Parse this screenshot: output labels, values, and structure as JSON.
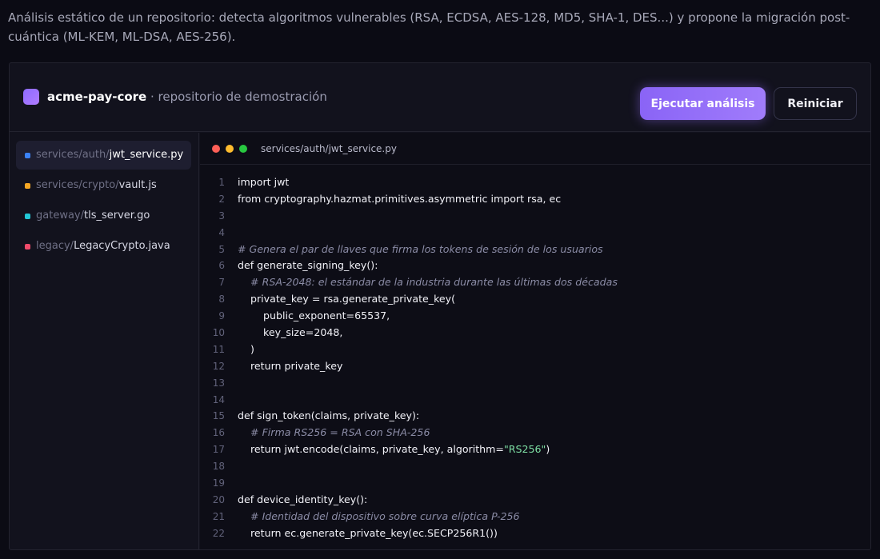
{
  "intro": "Análisis estático de un repositorio: detecta algoritmos vulnerables (RSA, ECDSA, AES-128, MD5, SHA-1, DES...) y propone la migración post-cuántica (ML-KEM, ML-DSA, AES-256).",
  "header": {
    "repo_name": "acme-pay-core",
    "separator": " · ",
    "repo_subtitle": "repositorio de demostración",
    "run_label": "Ejecutar análisis",
    "reset_label": "Reiniciar"
  },
  "colors": {
    "accent": "#9b72fa",
    "dot_blue": "#3b82f6",
    "dot_orange": "#f5a623",
    "dot_cyan": "#22c7d6",
    "dot_red": "#f04a6a"
  },
  "files": [
    {
      "dir": "services/auth/",
      "name": "jwt_service.py",
      "dot": "#3b82f6",
      "active": true
    },
    {
      "dir": "services/crypto/",
      "name": "vault.js",
      "dot": "#f5a623",
      "active": false
    },
    {
      "dir": "gateway/",
      "name": "tls_server.go",
      "dot": "#22c7d6",
      "active": false
    },
    {
      "dir": "legacy/",
      "name": "LegacyCrypto.java",
      "dot": "#f04a6a",
      "active": false
    }
  ],
  "editor": {
    "tab_path": "services/auth/jwt_service.py",
    "window_lights": [
      "#ff5f57",
      "#febc2e",
      "#28c840"
    ],
    "lines": [
      {
        "n": "1",
        "text": "import jwt"
      },
      {
        "n": "2",
        "text": "from cryptography.hazmat.primitives.asymmetric import rsa, ec"
      },
      {
        "n": "3",
        "text": ""
      },
      {
        "n": "4",
        "text": ""
      },
      {
        "n": "5",
        "text": "# Genera el par de llaves que firma los tokens de sesión de los usuarios",
        "comment": true
      },
      {
        "n": "6",
        "text": "def generate_signing_key():"
      },
      {
        "n": "7",
        "text": "    # RSA-2048: el estándar de la industria durante las últimas dos décadas",
        "comment": true
      },
      {
        "n": "8",
        "text": "    private_key = rsa.generate_private_key("
      },
      {
        "n": "9",
        "text": "        public_exponent=65537,"
      },
      {
        "n": "10",
        "text": "        key_size=2048,"
      },
      {
        "n": "11",
        "text": "    )"
      },
      {
        "n": "12",
        "text": "    return private_key"
      },
      {
        "n": "13",
        "text": ""
      },
      {
        "n": "14",
        "text": ""
      },
      {
        "n": "15",
        "text": "def sign_token(claims, private_key):"
      },
      {
        "n": "16",
        "text": "    # Firma RS256 = RSA con SHA-256",
        "comment": true
      },
      {
        "n": "17",
        "text": "    return jwt.encode(claims, private_key, algorithm=",
        "str": "\"RS256\"",
        "after": ")"
      },
      {
        "n": "18",
        "text": ""
      },
      {
        "n": "19",
        "text": ""
      },
      {
        "n": "20",
        "text": "def device_identity_key():"
      },
      {
        "n": "21",
        "text": "    # Identidad del dispositivo sobre curva elíptica P-256",
        "comment": true
      },
      {
        "n": "22",
        "text": "    return ec.generate_private_key(ec.SECP256R1())"
      }
    ]
  }
}
